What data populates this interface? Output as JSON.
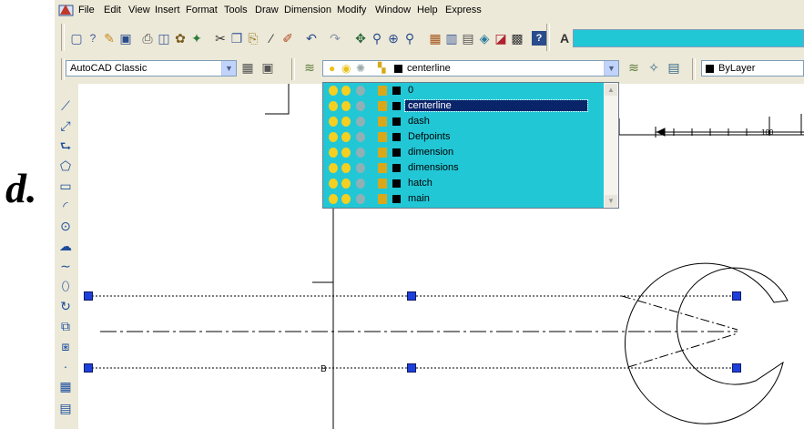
{
  "menu": [
    "File",
    "Edit",
    "View",
    "Insert",
    "Format",
    "Tools",
    "Draw",
    "Dimension",
    "Modify",
    "Window",
    "Help",
    "Express"
  ],
  "workspace": {
    "value": "AutoCAD Classic"
  },
  "layer_combo": {
    "value": "centerline"
  },
  "color_combo": {
    "value": "ByLayer"
  },
  "layers": [
    {
      "name": "0",
      "selected": false
    },
    {
      "name": "centerline",
      "selected": true
    },
    {
      "name": "dash",
      "selected": false
    },
    {
      "name": "Defpoints",
      "selected": false
    },
    {
      "name": "dimension",
      "selected": false
    },
    {
      "name": "dimensions",
      "selected": false
    },
    {
      "name": "hatch",
      "selected": false
    },
    {
      "name": "main",
      "selected": false
    }
  ],
  "figure_label": "d.",
  "drawing": {
    "point_label": "B",
    "dim_value": "100"
  },
  "colors": {
    "dropdown_bg": "#22c7d6",
    "selection": "#0a246a",
    "grip": "#1e3fd8",
    "chrome": "#ece9d8"
  }
}
